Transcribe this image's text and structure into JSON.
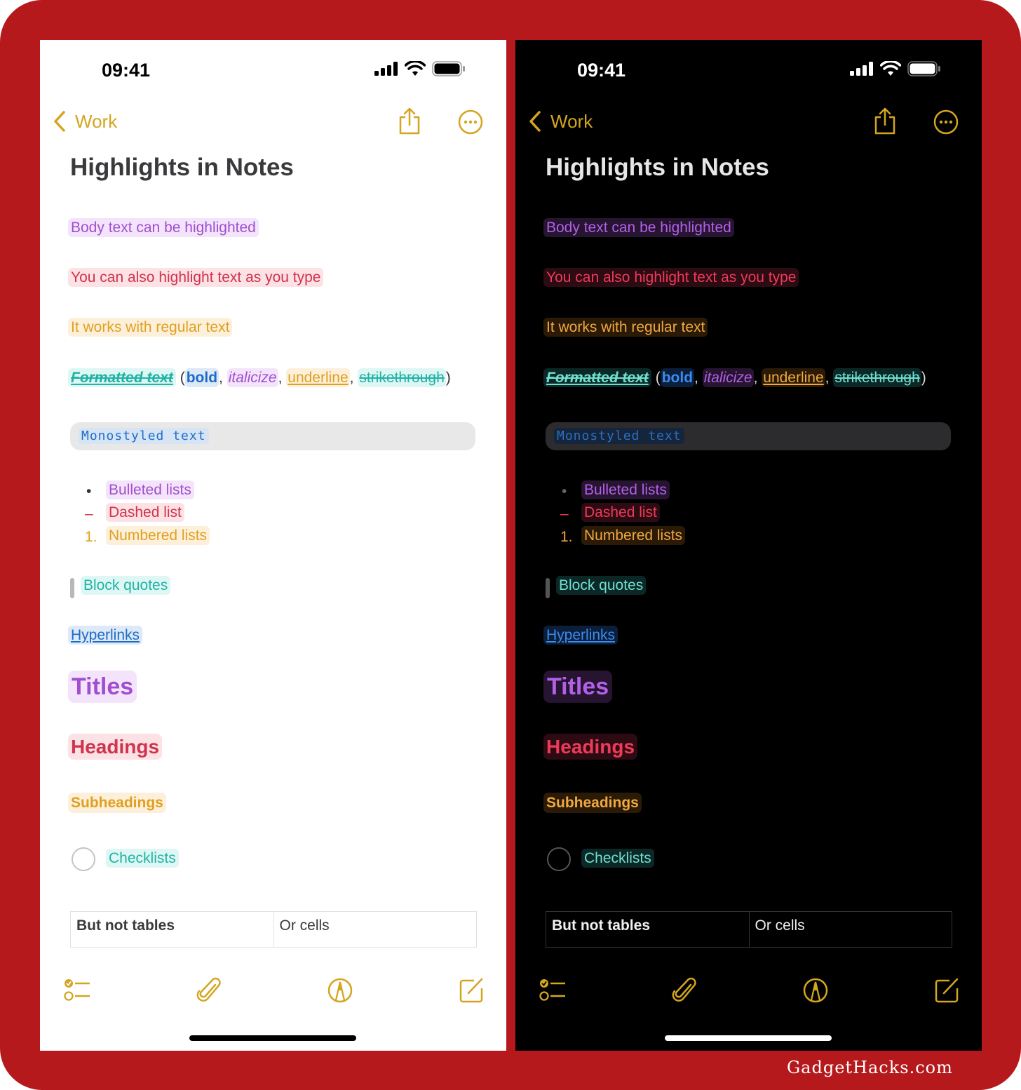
{
  "colors": {
    "frame": "#b5191c",
    "accent": "#d4a520",
    "purple": "#a04fcf",
    "red": "#d0334d",
    "orange": "#e0a020",
    "teal": "#20b3a4",
    "blue": "#1c6bc9"
  },
  "status": {
    "time": "09:41",
    "icons": [
      "cellular-signal-icon",
      "wifi-icon",
      "battery-icon"
    ]
  },
  "nav": {
    "back_label": "Work",
    "back_icon": "chevron-left-icon",
    "share_icon": "share-icon",
    "more_icon": "ellipsis-circle-icon"
  },
  "note": {
    "title": "Highlights in Notes",
    "body_line": "Body text can be highlighted",
    "type_line": "You can also highlight text as you type",
    "regular_line": "It works with regular text",
    "formatted": {
      "label": "Formatted text",
      "open_paren": "(",
      "bold": "bold",
      "italic": "italicize",
      "underline": "underline",
      "strike": "strikethrough",
      "comma": ",",
      "close_paren": ")"
    },
    "mono": "Monostyled text",
    "lists": [
      {
        "marker": "•",
        "text": "Bulleted lists"
      },
      {
        "marker": "–",
        "text": "Dashed list"
      },
      {
        "marker": "1.",
        "text": "Numbered lists"
      }
    ],
    "quote": "Block quotes",
    "hyperlink": "Hyperlinks",
    "titles": "Titles",
    "headings": "Headings",
    "subheadings": "Subheadings",
    "checklist": "Checklists",
    "table": {
      "rows": [
        [
          "But not tables",
          "Or cells"
        ]
      ]
    }
  },
  "toolbar": {
    "items": [
      "checklist-icon",
      "paperclip-icon",
      "markup-pen-icon",
      "compose-icon"
    ]
  },
  "watermark": "GadgetHacks.com"
}
